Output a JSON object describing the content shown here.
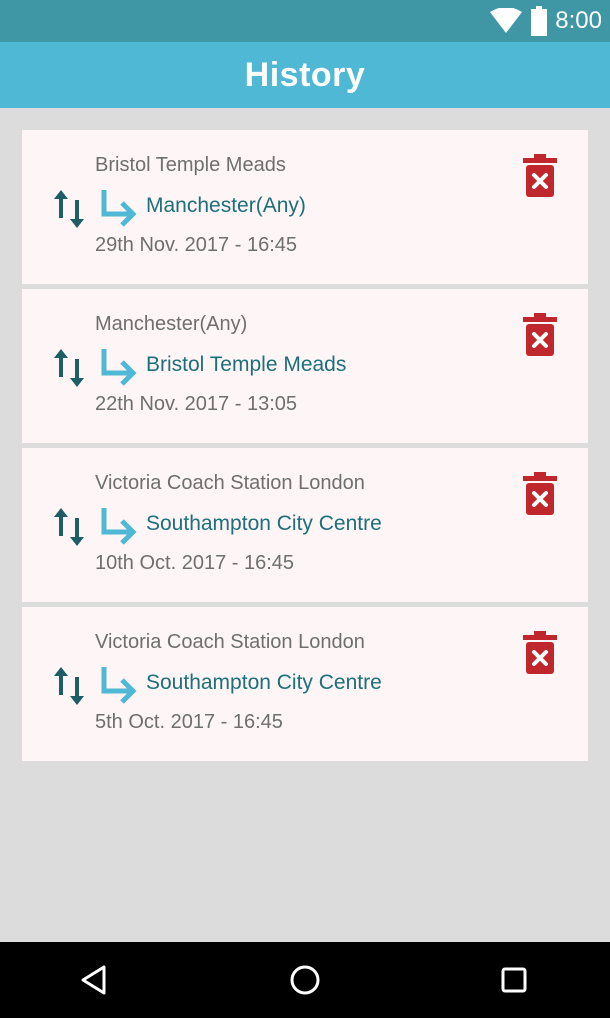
{
  "status_bar": {
    "time": "8:00",
    "icons": [
      "wifi-icon",
      "battery-icon"
    ]
  },
  "app_bar": {
    "title": "History"
  },
  "colors": {
    "status_bar": "#3f97a5",
    "app_bar": "#4fb8d4",
    "swap_icon": "#1d5e66",
    "arrow_icon": "#4fb8d4",
    "delete_icon": "#c0272d",
    "destination_text": "#1f6f7a",
    "secondary_text": "#6f6f6f",
    "card_background": "#fdf5f6"
  },
  "history": [
    {
      "from": "Bristol Temple Meads",
      "to": "Manchester(Any)",
      "date": "29th Nov. 2017 - 16:45"
    },
    {
      "from": "Manchester(Any)",
      "to": "Bristol Temple Meads",
      "date": "22th Nov. 2017 - 13:05"
    },
    {
      "from": "Victoria Coach Station London",
      "to": "Southampton City Centre",
      "date": "10th Oct. 2017 - 16:45"
    },
    {
      "from": "Victoria Coach Station London",
      "to": "Southampton City Centre",
      "date": "5th Oct. 2017 - 16:45"
    }
  ],
  "nav_bar": {
    "icons": [
      "back-triangle-icon",
      "home-circle-icon",
      "recents-square-icon"
    ]
  }
}
